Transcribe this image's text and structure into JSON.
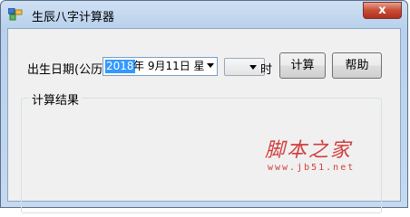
{
  "window": {
    "title": "生辰八字计算器",
    "close_label": "x"
  },
  "form": {
    "birth_date_label": "出生日期(公历)",
    "date_year": "2018",
    "date_rest": "年 9月11日 星",
    "hour_suffix": "时",
    "calc_button": "计算",
    "help_button": "帮助"
  },
  "result": {
    "group_title": "计算结果"
  },
  "watermark": {
    "logo_text": "脚本之家",
    "url": "www.jb51.net"
  },
  "colors": {
    "accent_selection": "#3399ff",
    "watermark": "#d23d3d"
  }
}
